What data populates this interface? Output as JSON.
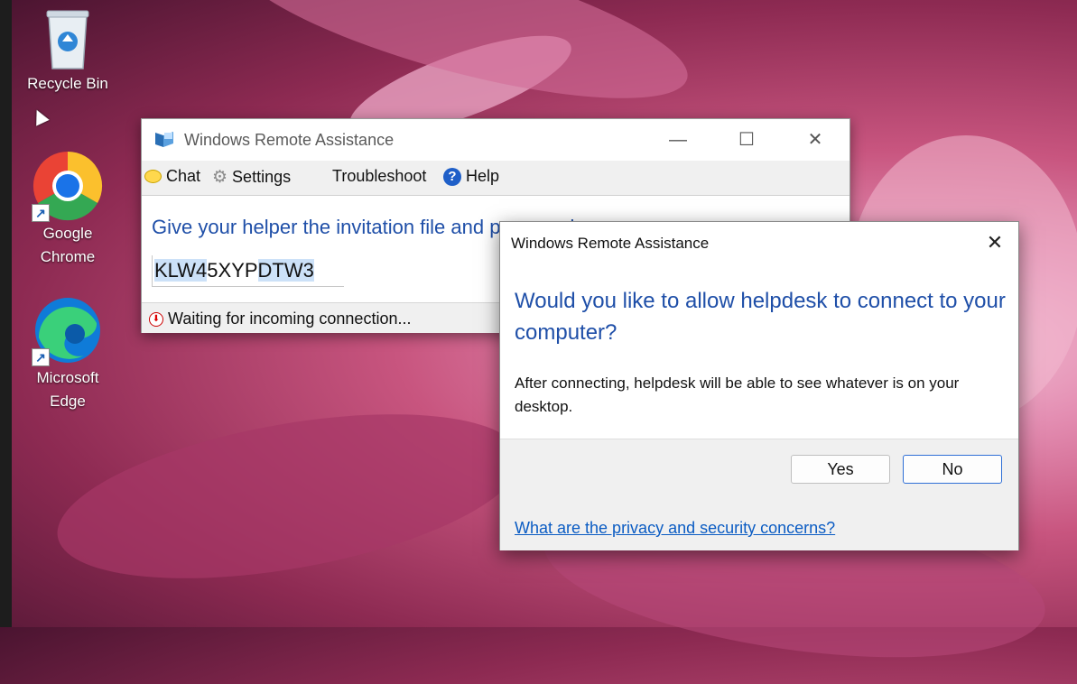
{
  "desktop": {
    "icons": [
      {
        "label": "Recycle Bin"
      },
      {
        "label_line1": "Google",
        "label_line2": "Chrome"
      },
      {
        "label_line1": "Microsoft",
        "label_line2": "Edge"
      }
    ]
  },
  "main_window": {
    "title": "Windows Remote Assistance",
    "menu": {
      "chat": "Chat",
      "settings": "Settings",
      "troubleshoot": "Troubleshoot",
      "help": "Help"
    },
    "instruction": "Give your helper the invitation file and password",
    "password_parts": [
      "KLW4",
      "5XYP",
      "DTW3"
    ],
    "status": "Waiting for incoming connection..."
  },
  "dialog": {
    "title": "Windows Remote Assistance",
    "heading": "Would you like to allow helpdesk to connect to your computer?",
    "body": "After connecting, helpdesk will be able to see whatever is on your desktop.",
    "yes_label": "Yes",
    "no_label": "No",
    "link": "What are the privacy and security concerns?"
  },
  "colors": {
    "heading_blue": "#1f4fa8",
    "link_blue": "#0b5cc3",
    "selection": "#cce1f8"
  }
}
